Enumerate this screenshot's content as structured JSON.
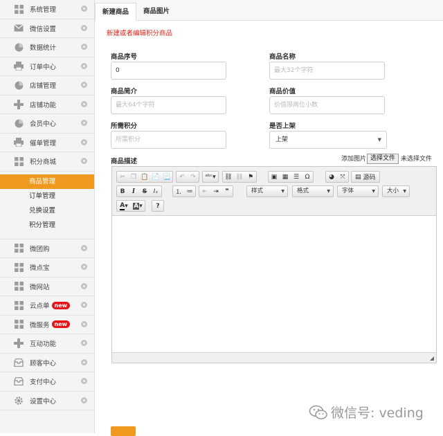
{
  "sidebar": {
    "items_top": [
      {
        "label": "系统管理",
        "icon": "grid-icon"
      },
      {
        "label": "微信设置",
        "icon": "mail-icon"
      },
      {
        "label": "数据统计",
        "icon": "pie-icon"
      },
      {
        "label": "订单中心",
        "icon": "printer-icon"
      },
      {
        "label": "店铺管理",
        "icon": "pie-icon"
      },
      {
        "label": "店铺功能",
        "icon": "plus-icon"
      },
      {
        "label": "会员中心",
        "icon": "pie-icon"
      },
      {
        "label": "催单管理",
        "icon": "printer-icon"
      },
      {
        "label": "积分商城",
        "icon": "grid-icon"
      }
    ],
    "sub_items": [
      {
        "label": "商品管理",
        "active": true
      },
      {
        "label": "订单管理",
        "active": false
      },
      {
        "label": "兑换设置",
        "active": false
      },
      {
        "label": "积分管理",
        "active": false
      }
    ],
    "items_bottom": [
      {
        "label": "微团购",
        "icon": "grid-icon",
        "badge": ""
      },
      {
        "label": "微点宝",
        "icon": "grid-icon",
        "badge": ""
      },
      {
        "label": "微网站",
        "icon": "grid-icon",
        "badge": ""
      },
      {
        "label": "云点单",
        "icon": "grid-icon",
        "badge": "new"
      },
      {
        "label": "微服务",
        "icon": "grid-icon",
        "badge": "new"
      },
      {
        "label": "互动功能",
        "icon": "plus-icon",
        "badge": ""
      },
      {
        "label": "顾客中心",
        "icon": "inbox-icon",
        "badge": ""
      },
      {
        "label": "支付中心",
        "icon": "inbox-icon",
        "badge": ""
      },
      {
        "label": "设置中心",
        "icon": "gear-icon",
        "badge": ""
      }
    ]
  },
  "tabs": [
    {
      "label": "新建商品",
      "active": true
    },
    {
      "label": "商品图片",
      "active": false
    }
  ],
  "form": {
    "hint": "新建或者编辑积分商品",
    "product_no_label": "商品序号",
    "product_no_value": "0",
    "product_name_label": "商品名称",
    "product_name_placeholder": "最大32个字符",
    "summary_label": "商品简介",
    "summary_placeholder": "最大64个字符",
    "price_label": "商品价值",
    "price_placeholder": "价值限两位小数",
    "points_label": "所需积分",
    "points_placeholder": "所需积分",
    "shelf_label": "是否上架",
    "shelf_value": "上架",
    "desc_label": "商品描述",
    "add_image_label": "添加图片",
    "choose_file_label": "选择文件",
    "no_file_label": "未选择文件"
  },
  "editor": {
    "source_label": "源码",
    "style_label": "样式",
    "format_label": "格式",
    "font_label": "字体",
    "size_label": "大小"
  },
  "watermark": "微信号: veding",
  "colors": {
    "accent": "#ef9a1e",
    "hint_red": "#e1251b",
    "badge_red": "#e5141b"
  }
}
